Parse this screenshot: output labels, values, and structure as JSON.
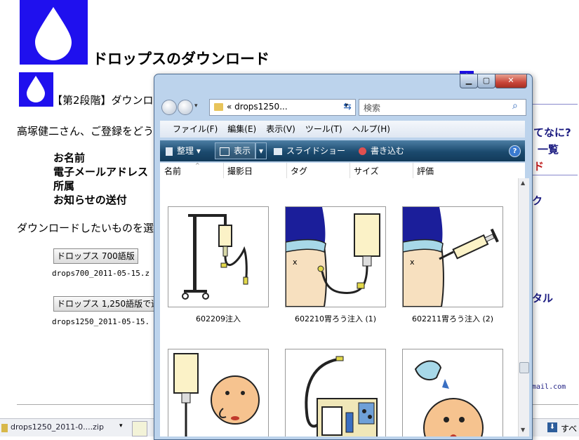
{
  "page": {
    "title": "ドロップスのダウンロード",
    "stage": "【第2段階】ダウンロ",
    "greeting": "高塚健二さん、ご登録をどうも",
    "fields": [
      "お名前",
      "電子メールアドレス",
      "所属",
      "お知らせの送付"
    ],
    "instruction": "ダウンロードしたいものを選ん",
    "button1": "ドロップス 700語版",
    "file1": "drops700_2011-05-15.z",
    "button2": "ドロップス 1,250語版で追",
    "file2": "drops1250_2011-05-15.",
    "right_texts": [
      "てなに?",
      "一覧",
      "ド",
      "ク",
      "タル"
    ],
    "right_email": "mail.com"
  },
  "download_bar": {
    "file": "drops1250_2011-0....zip",
    "right": "すべ"
  },
  "explorer": {
    "address": "« drops1250...",
    "search_placeholder": "検索",
    "menu": [
      "ファイル(F)",
      "編集(E)",
      "表示(V)",
      "ツール(T)",
      "ヘルプ(H)"
    ],
    "toolbar": {
      "organize": "整理",
      "view": "表示",
      "slideshow": "スライドショー",
      "burn": "書き込む"
    },
    "columns": [
      "名前",
      "撮影日",
      "タグ",
      "サイズ",
      "評価"
    ],
    "files": [
      {
        "name": "602209注入",
        "icon": "iv-stand-icon"
      },
      {
        "name": "602210胃ろう注入 (1)",
        "icon": "tube-feeding-icon"
      },
      {
        "name": "602211胃ろう注入 (2)",
        "icon": "syringe-feeding-icon"
      },
      {
        "name": "",
        "icon": "nasal-feeding-icon"
      },
      {
        "name": "",
        "icon": "suction-machine-icon"
      },
      {
        "name": "",
        "icon": "drinking-icon"
      }
    ]
  },
  "colors": {
    "brand_blue": "#1f10ee",
    "toolbar_dark": "#1b4a6e",
    "close_red": "#c9463a"
  }
}
